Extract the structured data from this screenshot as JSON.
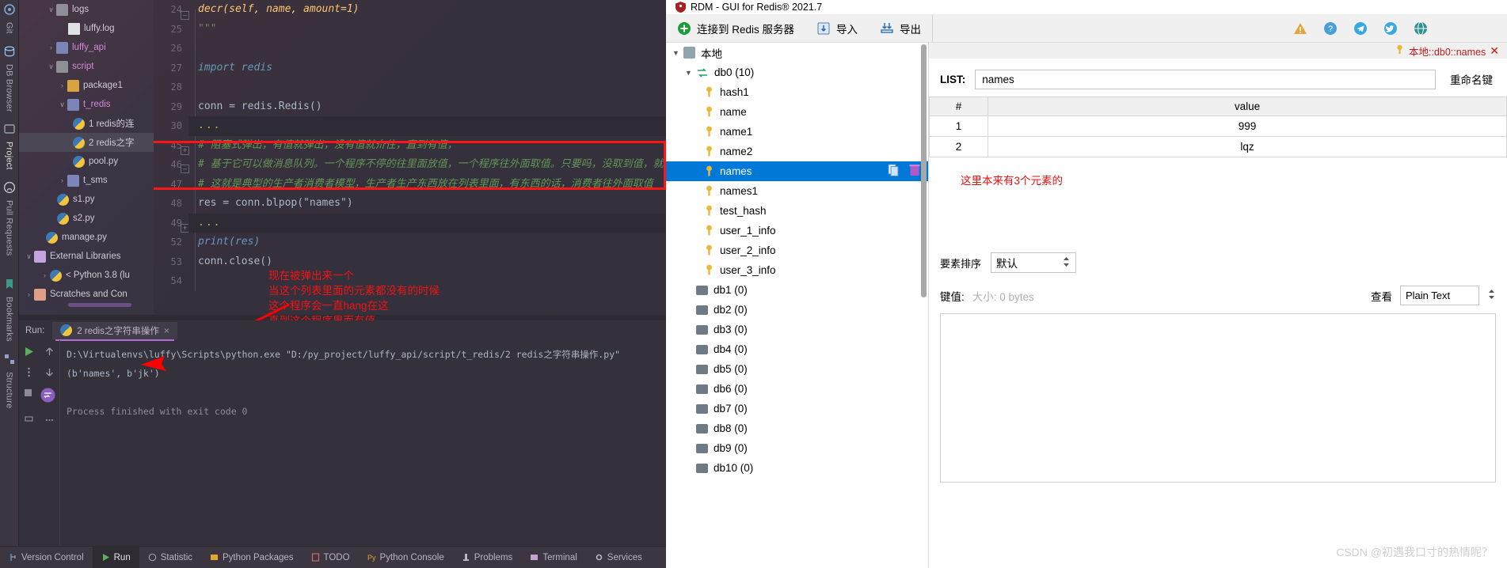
{
  "ide": {
    "left_toolbar": [
      {
        "label": "Git",
        "icon": "git-icon"
      },
      {
        "label": "DB Browser",
        "icon": "db-browser-icon"
      },
      {
        "label": "Project",
        "icon": "project-icon"
      },
      {
        "label": "Pull Requests",
        "icon": "github-icon"
      },
      {
        "label": "Bookmarks",
        "icon": "bookmarks-icon"
      },
      {
        "label": "Structure",
        "icon": "structure-icon"
      }
    ],
    "tree": [
      {
        "indent": 1,
        "arrow": "∨",
        "icon": "folder-gray",
        "label": "logs",
        "color": "white"
      },
      {
        "indent": 3,
        "arrow": "",
        "icon": "doc",
        "label": "luffy.log",
        "color": "white"
      },
      {
        "indent": 1,
        "arrow": "›",
        "icon": "folder-blue",
        "label": "luffy_api",
        "color": "pink"
      },
      {
        "indent": 1,
        "arrow": "∨",
        "icon": "folder-gray",
        "label": "script",
        "color": "pink"
      },
      {
        "indent": 2,
        "arrow": "›",
        "icon": "folder-yellow",
        "label": "package1",
        "color": "white"
      },
      {
        "indent": 2,
        "arrow": "∨",
        "icon": "folder-blue",
        "label": "t_redis",
        "color": "pink"
      },
      {
        "indent": 3,
        "arrow": "",
        "icon": "py",
        "label": "1 redis的连",
        "color": "white"
      },
      {
        "indent": 3,
        "arrow": "",
        "icon": "py",
        "label": "2 redis之字",
        "color": "white",
        "selected": true
      },
      {
        "indent": 3,
        "arrow": "",
        "icon": "py",
        "label": "pool.py",
        "color": "white"
      },
      {
        "indent": 2,
        "arrow": "›",
        "icon": "folder-blue",
        "label": "t_sms",
        "color": "white"
      },
      {
        "indent": 2,
        "arrow": "",
        "icon": "py",
        "label": "s1.py",
        "color": "white"
      },
      {
        "indent": 2,
        "arrow": "",
        "icon": "py",
        "label": "s2.py",
        "color": "white"
      },
      {
        "indent": 1,
        "arrow": "",
        "icon": "py",
        "label": "manage.py",
        "color": "white"
      },
      {
        "indent": 0,
        "arrow": "∨",
        "icon": "lib",
        "label": "External Libraries",
        "color": "white"
      },
      {
        "indent": 1,
        "arrow": "›",
        "icon": "py",
        "label": "< Python 3.8 (lu",
        "color": "white"
      },
      {
        "indent": 0,
        "arrow": "›",
        "icon": "scratch",
        "label": "Scratches and Con",
        "color": "white"
      }
    ],
    "editor": {
      "line_numbers": [
        "24",
        "25",
        "26",
        "27",
        "28",
        "29",
        "30",
        "45",
        "46",
        "47",
        "48",
        "49",
        "52",
        "53",
        "54"
      ],
      "code_lines": [
        {
          "type": "sig",
          "text": "decr(self, name, amount=1)"
        },
        {
          "type": "plain",
          "text": "\"\"\""
        },
        {
          "type": "blank",
          "text": ""
        },
        {
          "type": "import",
          "text": "import redis"
        },
        {
          "type": "blank",
          "text": ""
        },
        {
          "type": "conn",
          "text": "conn = redis.Redis()"
        },
        {
          "type": "dots",
          "text": "..."
        },
        {
          "type": "comment",
          "text": "#  阻塞式弹出，有值就弹出，没有值就夼住，直到有值，"
        },
        {
          "type": "comment",
          "text": "#  基于它可以做消息队列。一个程序不停的往里面放值，一个程序往外面取值。只要吗，没取到值，就一直卡在那"
        },
        {
          "type": "comment",
          "text": "#  这就是典型的生产者消费者模型，生产者生产东西放在列表里面，有东西的话，消费者往外面取值"
        },
        {
          "type": "blpop",
          "text": "res = conn.blpop(\"names\")"
        },
        {
          "type": "dots",
          "text": "..."
        },
        {
          "type": "print",
          "text": "print(res)"
        },
        {
          "type": "close",
          "text": "conn.close()"
        },
        {
          "type": "blank",
          "text": ""
        }
      ]
    },
    "annotations": {
      "code_note_lines": [
        "现在被弹出来一个",
        "当这个列表里面的元素都没有的时候",
        "这个程序会一直hang在这",
        "直到这个程序里面有值"
      ]
    },
    "run": {
      "label": "Run:",
      "tab_title": "2 redis之字符串操作",
      "close": "×",
      "command": "D:\\Virtualenvs\\luffy\\Scripts\\python.exe \"D:/py_project/luffy_api/script/t_redis/2 redis之字符串操作.py\"",
      "output": "(b'names', b'jk')",
      "finished": "Process finished with exit code 0"
    },
    "statusbar": [
      {
        "label": "Version Control",
        "icon": "version-control-icon"
      },
      {
        "label": "Run",
        "icon": "run-icon",
        "active": true
      },
      {
        "label": "Statistic",
        "icon": "statistic-icon"
      },
      {
        "label": "Python Packages",
        "icon": "packages-icon"
      },
      {
        "label": "TODO",
        "icon": "todo-icon"
      },
      {
        "label": "Python Console",
        "icon": "python-console-icon"
      },
      {
        "label": "Problems",
        "icon": "problems-icon"
      },
      {
        "label": "Terminal",
        "icon": "terminal-icon"
      },
      {
        "label": "Services",
        "icon": "services-icon"
      }
    ]
  },
  "rdm": {
    "window_title": "RDM - GUI for Redis® 2021.7",
    "toolbar": {
      "connect": "连接到 Redis 服务器",
      "import": "导入",
      "export": "导出",
      "icons": [
        "warning-icon",
        "help-icon",
        "telegram-icon",
        "twitter-icon",
        "globe-icon"
      ]
    },
    "tree": [
      {
        "indent": 0,
        "tri": "▼",
        "icon": "server-icon",
        "label": "本地"
      },
      {
        "indent": 1,
        "tri": "▼",
        "icon": "arrows-icon",
        "label": "db0  (10)"
      },
      {
        "indent": 2,
        "tri": "",
        "icon": "key-icon",
        "label": "hash1"
      },
      {
        "indent": 2,
        "tri": "",
        "icon": "key-icon",
        "label": "name"
      },
      {
        "indent": 2,
        "tri": "",
        "icon": "key-icon",
        "label": "name1"
      },
      {
        "indent": 2,
        "tri": "",
        "icon": "key-icon",
        "label": "name2"
      },
      {
        "indent": 2,
        "tri": "",
        "icon": "key-icon",
        "label": "names",
        "selected": true
      },
      {
        "indent": 2,
        "tri": "",
        "icon": "key-icon",
        "label": "names1"
      },
      {
        "indent": 2,
        "tri": "",
        "icon": "key-icon",
        "label": "test_hash"
      },
      {
        "indent": 2,
        "tri": "",
        "icon": "key-icon",
        "label": "user_1_info"
      },
      {
        "indent": 2,
        "tri": "",
        "icon": "key-icon",
        "label": "user_2_info"
      },
      {
        "indent": 2,
        "tri": "",
        "icon": "key-icon",
        "label": "user_3_info"
      },
      {
        "indent": 1,
        "tri": "",
        "icon": "db-icon",
        "label": "db1  (0)"
      },
      {
        "indent": 1,
        "tri": "",
        "icon": "db-icon",
        "label": "db2  (0)"
      },
      {
        "indent": 1,
        "tri": "",
        "icon": "db-icon",
        "label": "db3  (0)"
      },
      {
        "indent": 1,
        "tri": "",
        "icon": "db-icon",
        "label": "db4  (0)"
      },
      {
        "indent": 1,
        "tri": "",
        "icon": "db-icon",
        "label": "db5  (0)"
      },
      {
        "indent": 1,
        "tri": "",
        "icon": "db-icon",
        "label": "db6  (0)"
      },
      {
        "indent": 1,
        "tri": "",
        "icon": "db-icon",
        "label": "db7  (0)"
      },
      {
        "indent": 1,
        "tri": "",
        "icon": "db-icon",
        "label": "db8  (0)"
      },
      {
        "indent": 1,
        "tri": "",
        "icon": "db-icon",
        "label": "db9  (0)"
      },
      {
        "indent": 1,
        "tri": "",
        "icon": "db-icon",
        "label": "db10  (0)"
      }
    ],
    "value_panel": {
      "tab_label": "本地::db0::names",
      "tab_close": "✕",
      "type_label": "LIST:",
      "key_value": "names",
      "rename_button": "重命名键",
      "columns": [
        "#",
        "value"
      ],
      "rows": [
        {
          "index": "1",
          "value": "999"
        },
        {
          "index": "2",
          "value": "lqz"
        }
      ],
      "note": "这里本来有3个元素的",
      "sort_label": "要素排序",
      "sort_value": "默认",
      "key_label": "键值:",
      "size_label": "大小: 0 bytes",
      "view_label": "查看",
      "view_value": "Plain Text"
    },
    "watermark": "CSDN @初遇我口寸的热情呢？"
  }
}
